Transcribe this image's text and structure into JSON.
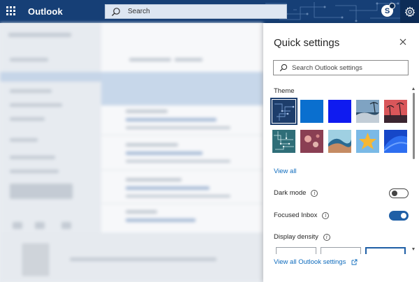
{
  "topbar": {
    "app_name": "Outlook",
    "search_placeholder": "Search",
    "skype_letter": "S",
    "background_color": "#163f76"
  },
  "panel": {
    "title": "Quick settings",
    "search_placeholder": "Search Outlook settings",
    "theme_label": "Theme",
    "view_all_label": "View all",
    "dark_mode_label": "Dark mode",
    "dark_mode_on": false,
    "focused_inbox_label": "Focused Inbox",
    "focused_inbox_on": true,
    "display_density_label": "Display density",
    "footer_link_label": "View all Outlook settings",
    "accent_color": "#0f6cbd"
  },
  "themes": [
    {
      "name": "circuit-dark-blue",
      "selected": true
    },
    {
      "name": "blue",
      "selected": false
    },
    {
      "name": "bright-blue",
      "selected": false
    },
    {
      "name": "palm-beach",
      "selected": false
    },
    {
      "name": "sunset-palms",
      "selected": false
    },
    {
      "name": "circuit-teal",
      "selected": false
    },
    {
      "name": "pink-bokeh",
      "selected": false
    },
    {
      "name": "wave",
      "selected": false
    },
    {
      "name": "star",
      "selected": false
    },
    {
      "name": "blue-swirl",
      "selected": false
    }
  ]
}
